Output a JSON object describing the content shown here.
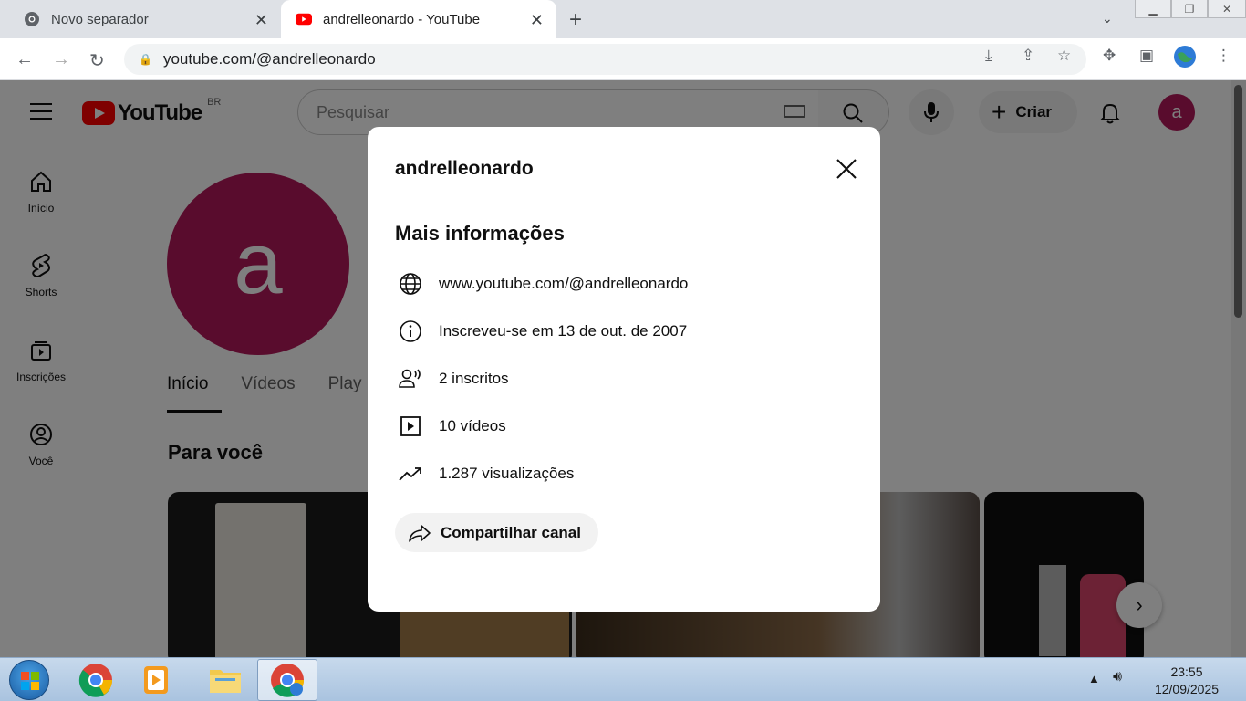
{
  "browser": {
    "tabs": [
      {
        "title": "Novo separador",
        "active": false
      },
      {
        "title": "andrelleonardo - YouTube",
        "active": true
      }
    ],
    "url": "youtube.com/@andrelleonardo"
  },
  "youtube": {
    "logo_text": "YouTube",
    "country_code": "BR",
    "search_placeholder": "Pesquisar",
    "create_label": "Criar",
    "user_initial": "a",
    "sidebar": [
      {
        "label": "Início",
        "icon": "home-icon"
      },
      {
        "label": "Shorts",
        "icon": "shorts-icon"
      },
      {
        "label": "Inscrições",
        "icon": "subscriptions-icon"
      },
      {
        "label": "Você",
        "icon": "you-icon"
      }
    ],
    "channel": {
      "initial": "a",
      "tabs": [
        "Início",
        "Vídeos",
        "Play"
      ],
      "section_title": "Para você"
    }
  },
  "dialog": {
    "title": "andrelleonardo",
    "subtitle": "Mais informações",
    "rows": [
      {
        "icon": "globe-icon",
        "text": "www.youtube.com/@andrelleonardo"
      },
      {
        "icon": "info-icon",
        "text": "Inscreveu-se em 13 de out. de 2007"
      },
      {
        "icon": "subscribers-icon",
        "text": "2 inscritos"
      },
      {
        "icon": "video-icon",
        "text": "10 vídeos"
      },
      {
        "icon": "trending-icon",
        "text": "1.287 visualizações"
      }
    ],
    "share_label": "Compartilhar canal"
  },
  "taskbar": {
    "time": "23:55",
    "date": "12/09/2025"
  },
  "colors": {
    "avatar": "#b3185a",
    "youtube_red": "#ff0000",
    "overlay": "rgba(0,0,0,0.5)"
  }
}
